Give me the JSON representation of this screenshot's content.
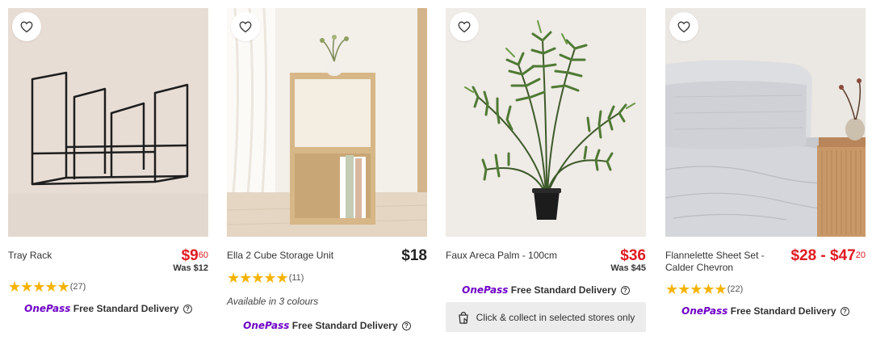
{
  "products": [
    {
      "name": "Tray Rack",
      "price_main": "$9",
      "price_cents": "60",
      "was_price": "Was $12",
      "stars_display": "★★★★★",
      "rating_count": "(27)",
      "onepass_logo": "OnePass",
      "delivery_text": "Free Standard Delivery"
    },
    {
      "name": "Ella 2 Cube Storage Unit",
      "price_main": "$18",
      "stars_display": "★★★★★",
      "rating_count": "(11)",
      "colours_text": "Available in 3 colours",
      "onepass_logo": "OnePass",
      "delivery_text": "Free Standard Delivery"
    },
    {
      "name": "Faux Areca Palm - 100cm",
      "price_main": "$36",
      "was_price": "Was $45",
      "onepass_logo": "OnePass",
      "delivery_text": "Free Standard Delivery",
      "click_collect": "Click & collect in selected stores only"
    },
    {
      "name_line1": "Flannelette Sheet Set -",
      "name_line2": "Calder Chevron",
      "price_main": "$28 - $47",
      "price_cents": "20",
      "stars_display": "★★★★★",
      "rating_count": "(22)",
      "onepass_logo": "OnePass",
      "delivery_text": "Free Standard Delivery"
    }
  ],
  "colors": {
    "sale_red": "#e01a22",
    "onepass_purple": "#6f00c7",
    "star_gold": "#f5b301"
  },
  "icons": [
    "heart-icon",
    "info-icon",
    "click-collect-icon"
  ]
}
